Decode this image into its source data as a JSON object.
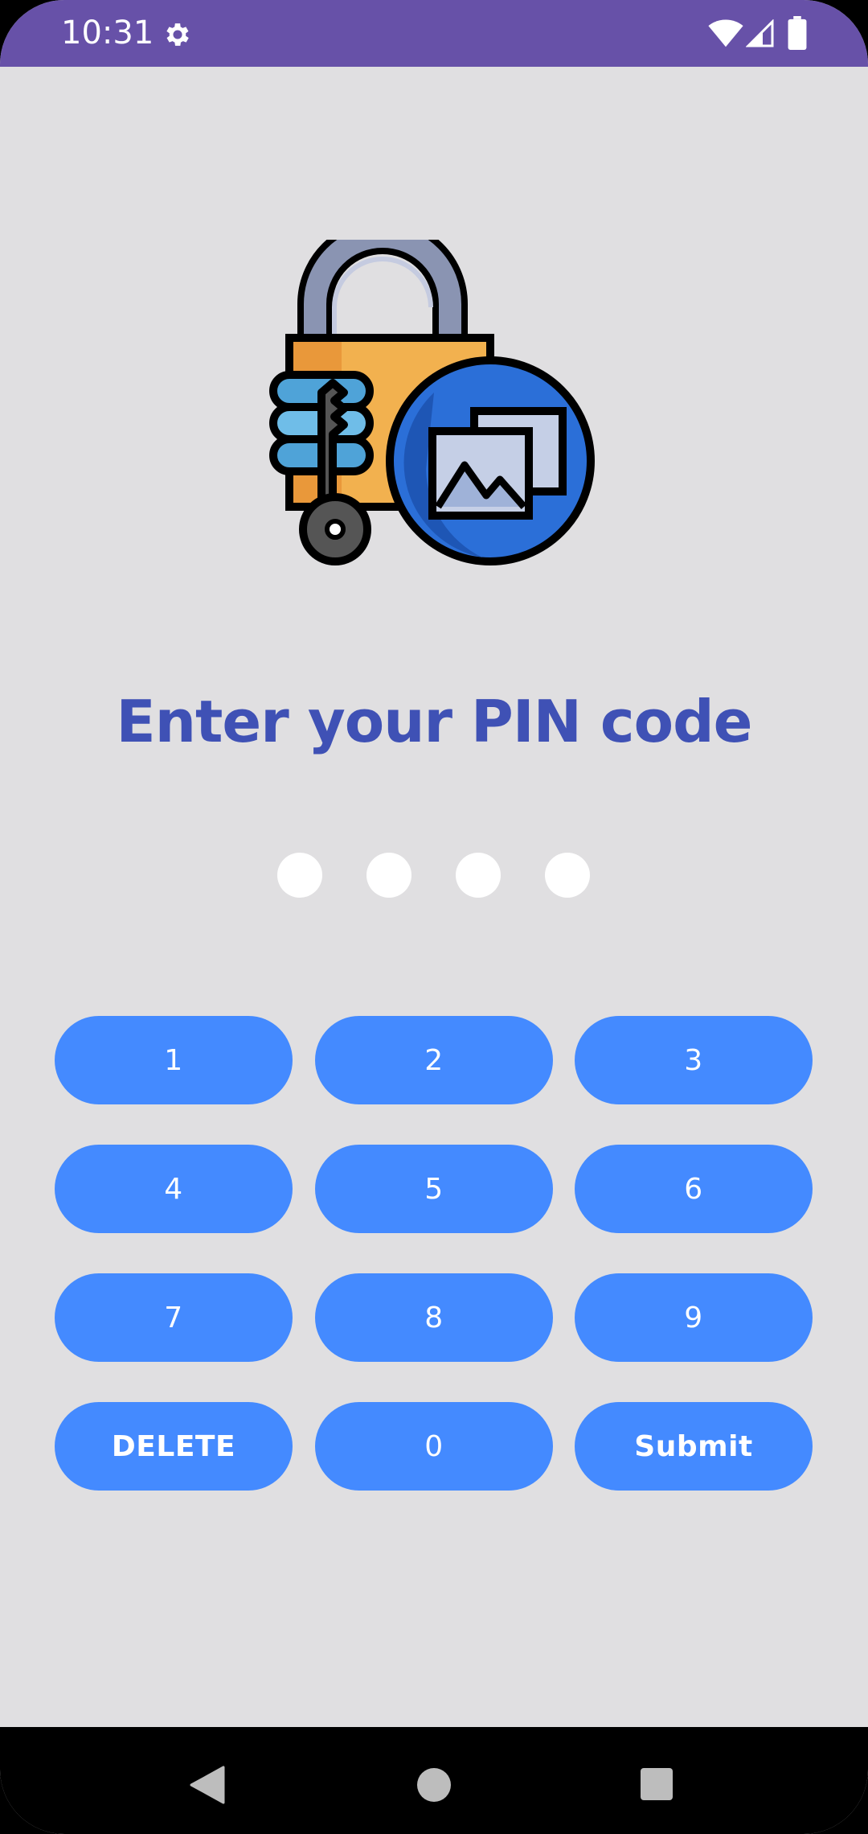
{
  "status": {
    "time": "10:31",
    "settings_icon": "gear-icon",
    "wifi_icon": "wifi-icon",
    "signal_icon": "cell-signal-icon",
    "battery_icon": "battery-icon",
    "bar_color": "#6751a8"
  },
  "hero": {
    "icon": "padlock-key-gallery-illustration"
  },
  "title": "Enter your PIN code",
  "pin": {
    "length": 4,
    "entered": 0
  },
  "keypad": {
    "keys": [
      {
        "label": "1"
      },
      {
        "label": "2"
      },
      {
        "label": "3"
      },
      {
        "label": "4"
      },
      {
        "label": "5"
      },
      {
        "label": "6"
      },
      {
        "label": "7"
      },
      {
        "label": "8"
      },
      {
        "label": "9"
      },
      {
        "label": "DELETE"
      },
      {
        "label": "0"
      },
      {
        "label": "Submit"
      }
    ],
    "button_color": "#448aff"
  },
  "navbar": {
    "back_icon": "back-triangle-icon",
    "home_icon": "home-circle-icon",
    "recents_icon": "recents-square-icon"
  },
  "colors": {
    "background": "#e0dfe1",
    "title": "#3f51b5"
  }
}
